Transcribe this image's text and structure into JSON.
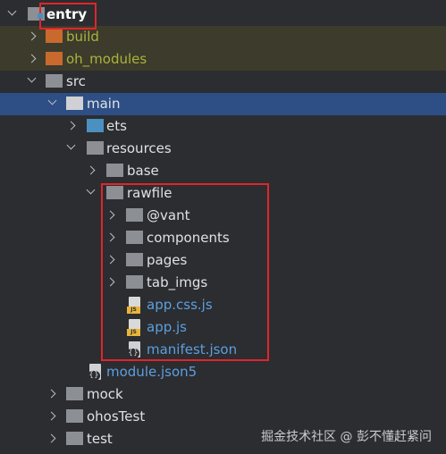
{
  "tree": {
    "entry": {
      "label": "entry"
    },
    "build": {
      "label": "build"
    },
    "oh_modules": {
      "label": "oh_modules"
    },
    "src": {
      "label": "src"
    },
    "main": {
      "label": "main"
    },
    "ets": {
      "label": "ets"
    },
    "resources": {
      "label": "resources"
    },
    "base": {
      "label": "base"
    },
    "rawfile": {
      "label": "rawfile"
    },
    "vant": {
      "label": "@vant"
    },
    "components": {
      "label": "components"
    },
    "pages": {
      "label": "pages"
    },
    "tab_imgs": {
      "label": "tab_imgs"
    },
    "app_css_js": {
      "label": "app.css.js",
      "badge": "JS"
    },
    "app_js": {
      "label": "app.js",
      "badge": "JS"
    },
    "manifest_json": {
      "label": "manifest.json",
      "badge": "{}"
    },
    "module_json5": {
      "label": "module.json5",
      "badge": "{}"
    },
    "mock": {
      "label": "mock"
    },
    "ohosTest": {
      "label": "ohosTest"
    },
    "test": {
      "label": "test"
    }
  },
  "watermark": "掘金技术社区 @ 彭不懂赶紧问",
  "colors": {
    "background": "#2b2d30",
    "selected_row": "#2e4f85",
    "excluded_row": "#3d3b2b",
    "excluded_text": "#aab33c",
    "file_link_text": "#5d9fe0",
    "highlight_box": "#e0252b"
  },
  "icons": {
    "folder": "folder-icon",
    "module_folder": "module-folder-icon",
    "excluded_folder": "excluded-folder-icon",
    "source_folder": "source-folder-icon",
    "js_file": "js-file-icon",
    "json_file": "json-file-icon",
    "chevron_down": "chevron-down-icon",
    "chevron_right": "chevron-right-icon"
  }
}
